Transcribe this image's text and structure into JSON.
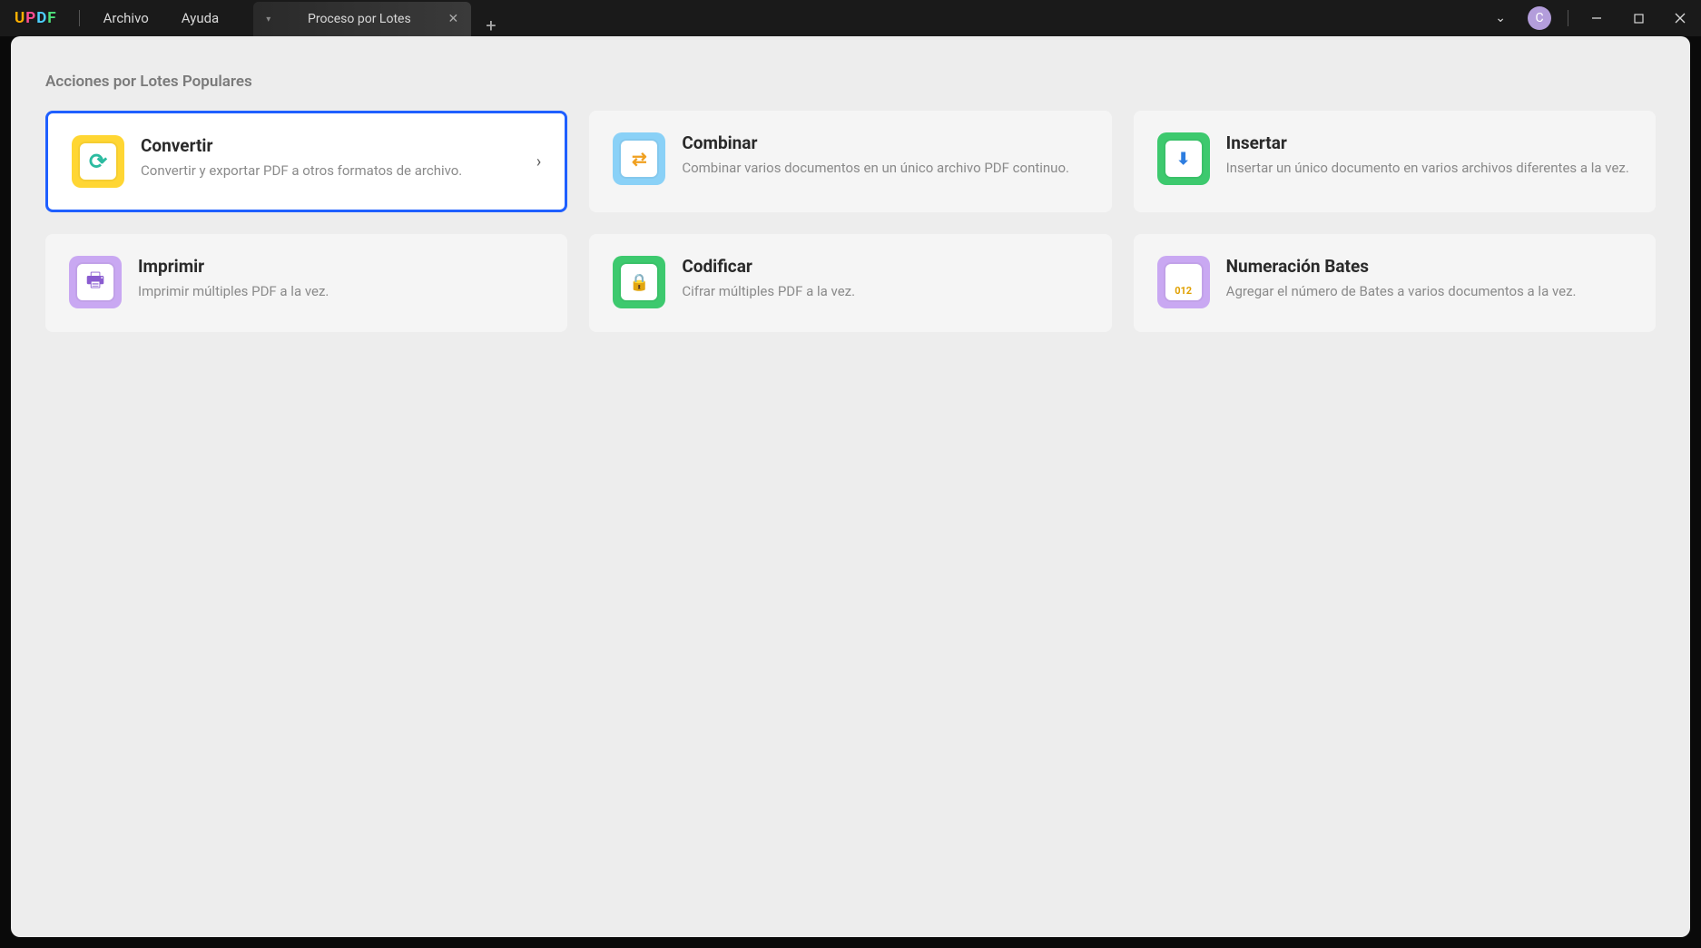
{
  "app": {
    "logo_text": "UPDF"
  },
  "menu": {
    "file": "Archivo",
    "help": "Ayuda"
  },
  "tabs": [
    {
      "label": "Proceso por Lotes"
    }
  ],
  "user": {
    "initial": "C"
  },
  "section": {
    "title": "Acciones por Lotes Populares"
  },
  "cards": [
    {
      "id": "convert",
      "icon": "convert-icon",
      "icon_bg": "yellow",
      "title": "Convertir",
      "desc": "Convertir y exportar PDF a otros formatos de archivo.",
      "selected": true
    },
    {
      "id": "combine",
      "icon": "combine-icon",
      "icon_bg": "blue",
      "title": "Combinar",
      "desc": "Combinar varios documentos en un único archivo PDF continuo.",
      "selected": false
    },
    {
      "id": "insert",
      "icon": "insert-icon",
      "icon_bg": "green",
      "title": "Insertar",
      "desc": "Insertar un único documento en varios archivos diferentes a la vez.",
      "selected": false
    },
    {
      "id": "print",
      "icon": "print-icon",
      "icon_bg": "purple",
      "title": "Imprimir",
      "desc": "Imprimir múltiples PDF a la vez.",
      "selected": false
    },
    {
      "id": "encrypt",
      "icon": "encrypt-icon",
      "icon_bg": "green",
      "title": "Codificar",
      "desc": "Cifrar múltiples PDF a la vez.",
      "selected": false
    },
    {
      "id": "bates",
      "icon": "bates-icon",
      "icon_bg": "purple",
      "title": "Numeración Bates",
      "desc": "Agregar el número de Bates a varios documentos a la vez.",
      "selected": false
    }
  ],
  "bates_label": "012"
}
